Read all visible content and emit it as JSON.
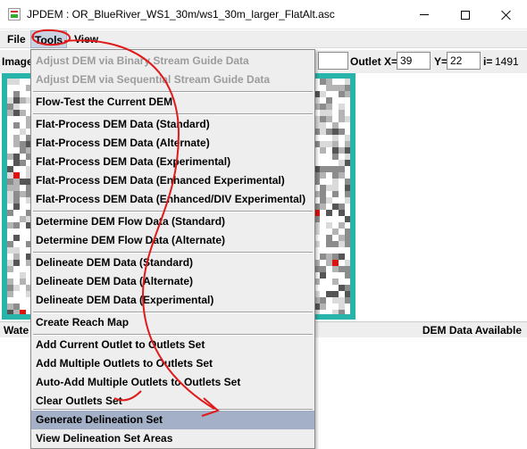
{
  "window": {
    "title": "JPDEM : OR_BlueRiver_WS1_30m/ws1_30m_larger_FlatAlt.asc",
    "minimize_icon": "minimize-icon",
    "maximize_icon": "maximize-icon",
    "close_icon": "close-icon"
  },
  "menubar": {
    "file": "File",
    "tools": "Tools",
    "view": "View"
  },
  "toolbar": {
    "image_label": "Image",
    "outlet_x_label": "Outlet X=",
    "outlet_x_value": "39",
    "y_label": "Y=",
    "y_value": "22",
    "i_label": "i=",
    "i_value": "1491"
  },
  "statusbar": {
    "left": "Wate",
    "right": "DEM Data Available"
  },
  "tools_menu": {
    "items": [
      {
        "label": "Adjust DEM via Binary Stream Guide Data",
        "enabled": false
      },
      {
        "label": "Adjust DEM via Sequential Stream Guide Data",
        "enabled": false
      },
      {
        "label": "Flow-Test the Current DEM",
        "enabled": true
      },
      {
        "label": "Flat-Process DEM Data (Standard)",
        "enabled": true
      },
      {
        "label": "Flat-Process DEM Data (Alternate)",
        "enabled": true
      },
      {
        "label": "Flat-Process DEM Data (Experimental)",
        "enabled": true
      },
      {
        "label": "Flat-Process DEM Data (Enhanced Experimental)",
        "enabled": true
      },
      {
        "label": "Flat-Process DEM Data (Enhanced/DIV Experimental)",
        "enabled": true
      },
      {
        "label": "Determine DEM Flow Data (Standard)",
        "enabled": true
      },
      {
        "label": "Determine DEM Flow Data (Alternate)",
        "enabled": true
      },
      {
        "label": "Delineate DEM Data (Standard)",
        "enabled": true
      },
      {
        "label": "Delineate DEM Data (Alternate)",
        "enabled": true
      },
      {
        "label": "Delineate DEM Data (Experimental)",
        "enabled": true
      },
      {
        "label": "Create Reach Map",
        "enabled": true
      },
      {
        "label": "Add Current Outlet to Outlets Set",
        "enabled": true
      },
      {
        "label": "Add Multiple Outlets to Outlets Set",
        "enabled": true
      },
      {
        "label": "Auto-Add Multiple Outlets to Outlets Set",
        "enabled": true
      },
      {
        "label": "Clear Outlets Set",
        "enabled": true
      },
      {
        "label": "Generate Delineation Set",
        "enabled": true,
        "selected": true
      },
      {
        "label": "View Delineation Set Areas",
        "enabled": true
      }
    ]
  },
  "colors": {
    "map_border": "#28b4aa",
    "selection": "#a3b0c8",
    "annotation": "#e01b1b"
  }
}
